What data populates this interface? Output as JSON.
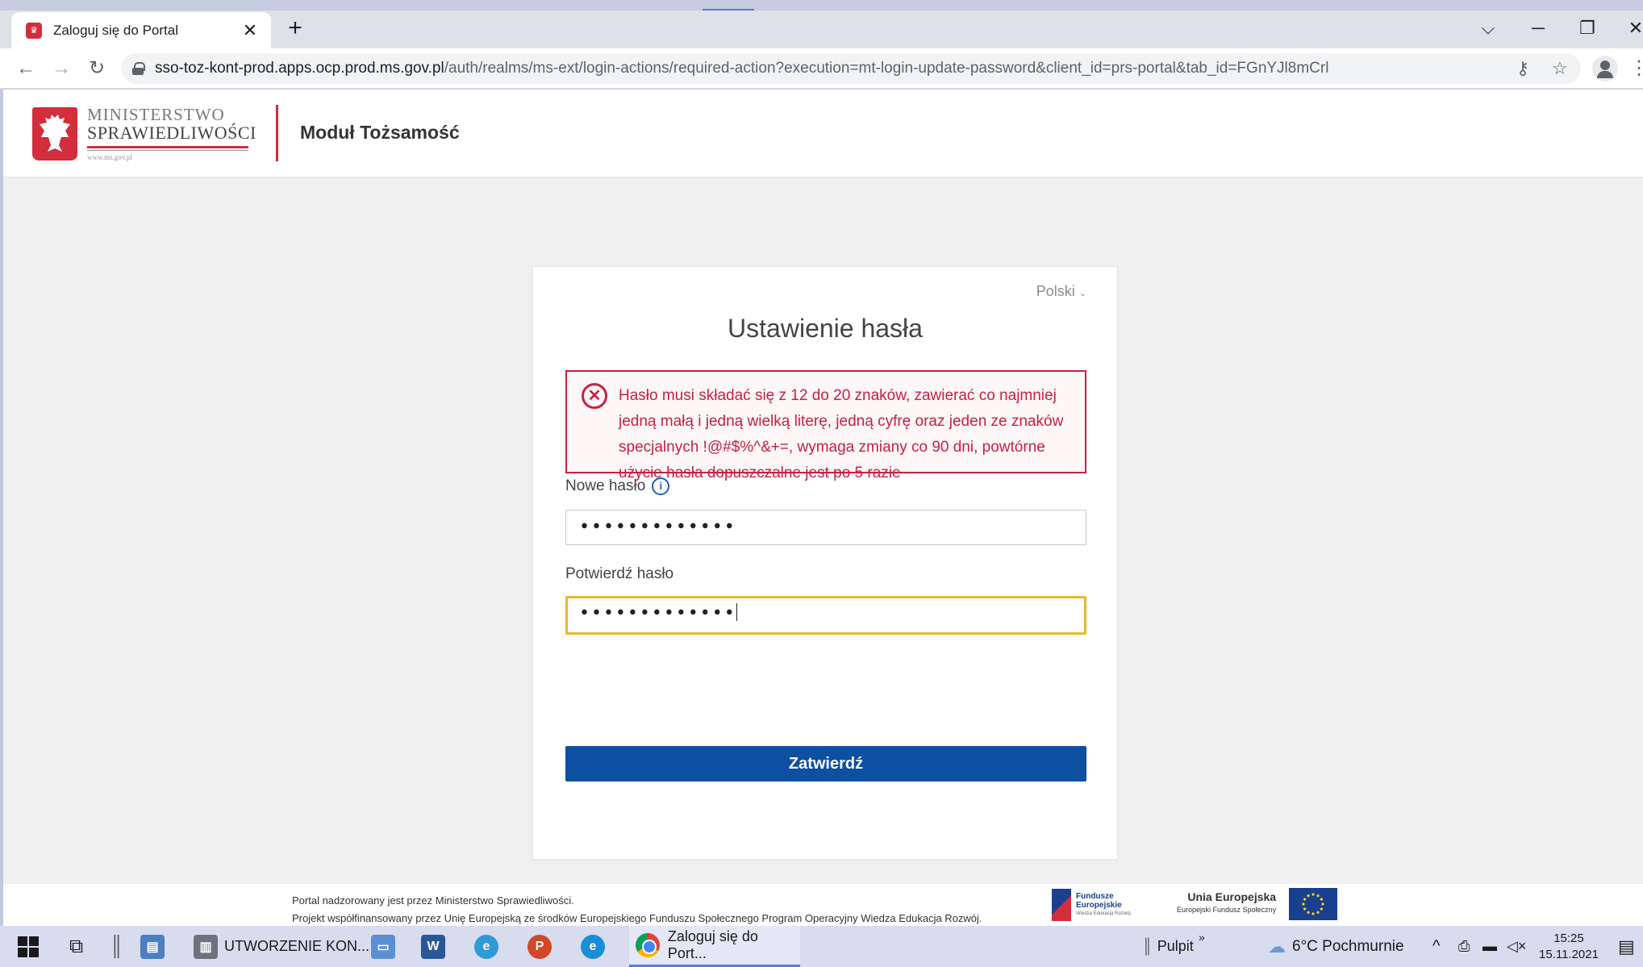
{
  "browser": {
    "tab_title": "Zaloguj się do Portal",
    "url_host": "sso-toz-kont-prod.apps.ocp.prod.ms.gov.pl",
    "url_path": "/auth/realms/ms-ext/login-actions/required-action?execution=mt-login-update-password&client_id=prs-portal&tab_id=FGnYJl8mCrl"
  },
  "header": {
    "ministry_line1": "MINISTERSTWO",
    "ministry_line2": "SPRAWIEDLIWOŚCI",
    "ministry_www": "www.ms.gov.pl",
    "module_title": "Moduł Tożsamość"
  },
  "card": {
    "language": "Polski",
    "title": "Ustawienie hasła",
    "error_message": "Hasło musi składać się z 12 do 20 znaków, zawierać co najmniej jedną małą i jedną wielką literę, jedną cyfrę oraz jeden ze znaków specjalnych !@#$%^&+=, wymaga zmiany co 90 dni, powtórne użycie hasła dopuszczalne jest po 5 razie",
    "new_password_label": "Nowe hasło",
    "new_password_value": "•••••••••••••",
    "confirm_password_label": "Potwierdź hasło",
    "confirm_password_value": "•••••••••••••",
    "submit_label": "Zatwierdź"
  },
  "footer": {
    "line1": "Portal nadzorowany jest przez Ministerstwo Sprawiedliwości.",
    "line2": "Projekt współfinansowany przez Unię Europejską ze środków Europejskiego Funduszu Społecznego Program Operacyjny Wiedza Edukacja Rozwój.",
    "fe_line1": "Fundusze",
    "fe_line2": "Europejskie",
    "fe_line3": "Wiedza Edukacja Rozwój",
    "eu_title": "Unia Europejska",
    "eu_sub": "Europejski Fundusz Społeczny"
  },
  "taskbar": {
    "task1": "UTWORZENIE KON...",
    "task_chrome": "Zaloguj się do Port...",
    "desktop": "Pulpit",
    "weather": "6°C  Pochmurnie",
    "time": "15:25",
    "date": "15.11.2021"
  },
  "colors": {
    "error": "#c9203f",
    "primary": "#0d4fa0",
    "focus_outline": "#e8b92e",
    "brand_red": "#d42d3b"
  }
}
